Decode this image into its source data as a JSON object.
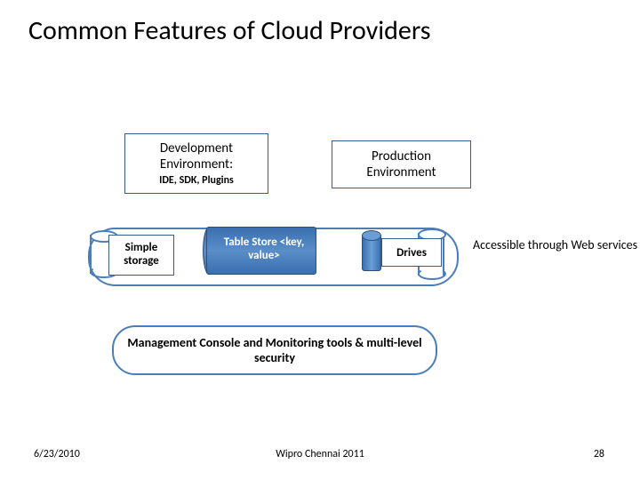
{
  "title": "Common Features of Cloud Providers",
  "dev": {
    "line1": "Development",
    "line2": "Environment:",
    "sub": "IDE, SDK, Plugins"
  },
  "prod": {
    "line1": "Production",
    "line2": "Environment"
  },
  "storage": {
    "simple": "Simple storage",
    "table": "Table Store <key, value>",
    "drives": "Drives",
    "access": "Accessible through Web services"
  },
  "mgmt": "Management Console and Monitoring tools & multi-level security",
  "footer": {
    "date": "6/23/2010",
    "venue": "Wipro Chennai 2011",
    "page": "28"
  }
}
